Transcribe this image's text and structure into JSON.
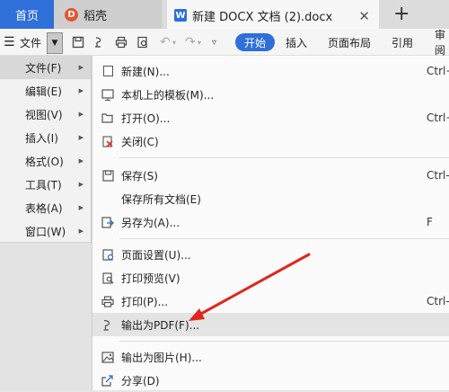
{
  "tabs": {
    "home": "首页",
    "daoke": "稻壳",
    "document": "新建 DOCX 文档 (2).docx",
    "close_glyph": "✕",
    "add_glyph": "+"
  },
  "toolbar": {
    "file_label": "文件",
    "ribbon": [
      "开始",
      "插入",
      "页面布局",
      "引用",
      "审阅"
    ]
  },
  "left_menu": [
    {
      "label": "文件(F)",
      "active": true
    },
    {
      "label": "编辑(E)"
    },
    {
      "label": "视图(V)"
    },
    {
      "label": "插入(I)"
    },
    {
      "label": "格式(O)"
    },
    {
      "label": "工具(T)"
    },
    {
      "label": "表格(A)"
    },
    {
      "label": "窗口(W)"
    }
  ],
  "file_menu": [
    {
      "label": "新建(N)...",
      "shortcut": "Ctrl+",
      "icon": "new-doc-icon"
    },
    {
      "label": "本机上的模板(M)...",
      "shortcut": "",
      "icon": "template-icon"
    },
    {
      "label": "打开(O)...",
      "shortcut": "Ctrl+",
      "icon": "open-folder-icon"
    },
    {
      "label": "关闭(C)",
      "shortcut": "",
      "icon": "close-doc-icon"
    },
    {
      "label": "保存(S)",
      "shortcut": "Ctrl-",
      "icon": "save-icon"
    },
    {
      "label": "保存所有文档(E)",
      "shortcut": "",
      "icon": ""
    },
    {
      "label": "另存为(A)...",
      "shortcut": "F",
      "icon": "save-as-icon"
    },
    {
      "label": "页面设置(U)...",
      "shortcut": "",
      "icon": "page-setup-icon"
    },
    {
      "label": "打印预览(V)",
      "shortcut": "",
      "icon": "print-preview-icon"
    },
    {
      "label": "打印(P)...",
      "shortcut": "Ctrl-",
      "icon": "print-icon"
    },
    {
      "label": "输出为PDF(F)...",
      "shortcut": "",
      "icon": "export-pdf-icon",
      "highlighted": true
    },
    {
      "label": "输出为图片(H)...",
      "shortcut": "",
      "icon": "export-image-icon"
    },
    {
      "label": "分享(D)",
      "shortcut": "",
      "icon": "share-icon"
    }
  ],
  "colors": {
    "accent": "#2e6fd9",
    "annotation_arrow": "#e0261f"
  }
}
